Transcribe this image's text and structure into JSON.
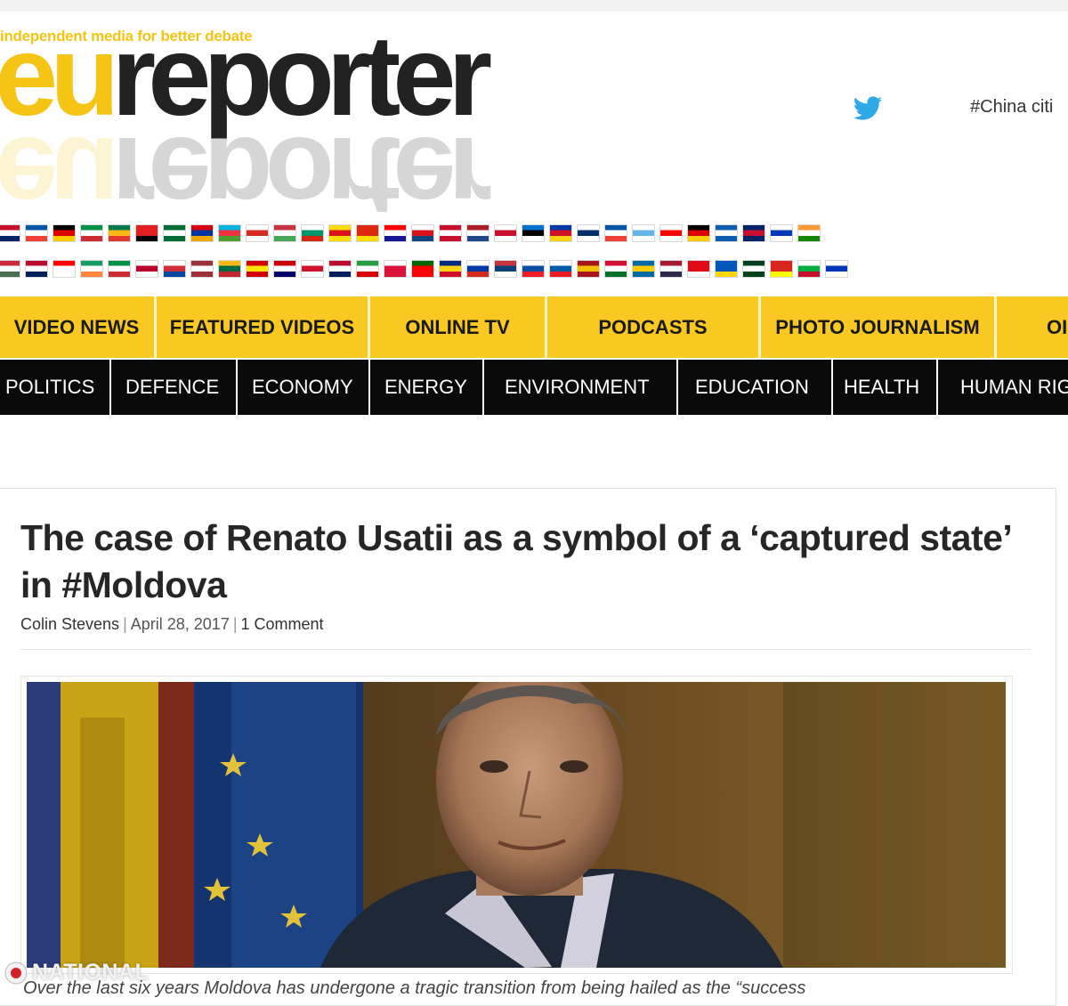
{
  "header": {
    "tagline": "independent media for better debate",
    "logo_eu": "eu",
    "logo_reporter": "reporter",
    "ticker": "#China citi"
  },
  "nav_primary": [
    {
      "label": "VIDEO NEWS"
    },
    {
      "label": "FEATURED VIDEOS"
    },
    {
      "label": "ONLINE TV"
    },
    {
      "label": "PODCASTS"
    },
    {
      "label": "PHOTO JOURNALISM"
    },
    {
      "label": "OI"
    }
  ],
  "nav_secondary": [
    {
      "label": "POLITICS"
    },
    {
      "label": "DEFENCE"
    },
    {
      "label": "ECONOMY"
    },
    {
      "label": "ENERGY"
    },
    {
      "label": "ENVIRONMENT"
    },
    {
      "label": "EDUCATION"
    },
    {
      "label": "HEALTH"
    },
    {
      "label": "HUMAN RIG"
    }
  ],
  "article": {
    "title": "The case of Renato Usatii as a symbol of a ‘captured state’ in #Moldova",
    "author": "Colin Stevens",
    "date": "April 28, 2017",
    "comments": "1 Comment",
    "excerpt": "Over the last six years Moldova has undergone a tragic transition from being hailed as the “success"
  },
  "watermark": {
    "text": "NATIONAL"
  },
  "colors": {
    "brand_yellow": "#f5c414",
    "nav_yellow": "#f9c823",
    "nav_black": "#0a0a0a",
    "twitter": "#2fa8e6"
  },
  "icons": {
    "twitter": "twitter-bird-icon"
  }
}
